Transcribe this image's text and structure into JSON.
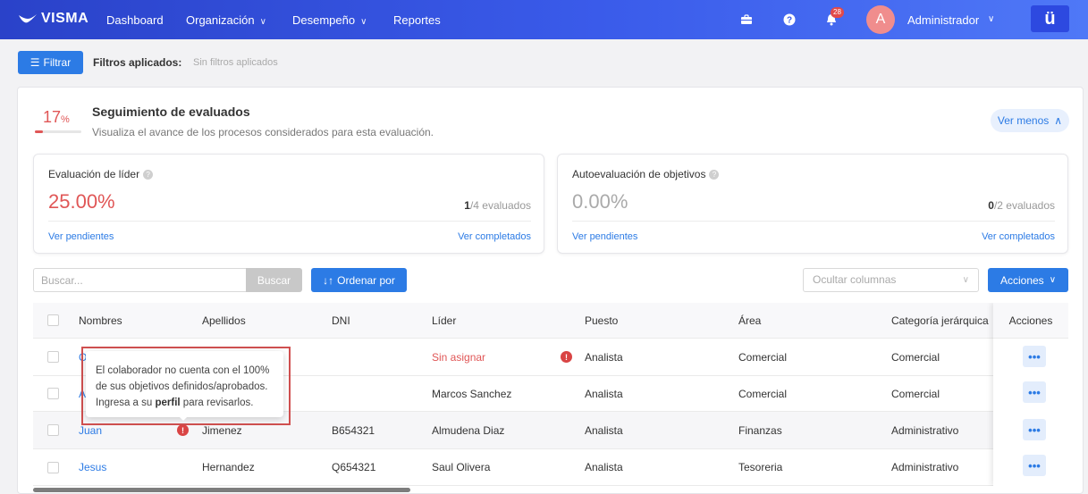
{
  "brand": {
    "logo": "VISMA",
    "app_mark": "ü",
    "accent": "#2c7be5",
    "alert": "#e05656"
  },
  "nav": {
    "items": [
      {
        "label": "Dashboard",
        "dropdown": false
      },
      {
        "label": "Organización",
        "dropdown": true
      },
      {
        "label": "Desempeño",
        "dropdown": true
      },
      {
        "label": "Reportes",
        "dropdown": false
      }
    ],
    "icons": [
      "briefcase-icon",
      "help-icon",
      "bell-icon"
    ],
    "notifications_count": "28",
    "user": {
      "initial": "A",
      "name": "Administrador"
    }
  },
  "filters": {
    "button_label": "Filtrar",
    "applied_label": "Filtros aplicados:",
    "applied_value": "Sin filtros aplicados"
  },
  "tracking": {
    "percent": "17",
    "percent_unit": "%",
    "progress": 0.17,
    "title": "Seguimiento de evaluados",
    "subtitle": "Visualiza el avance de los procesos considerados para esta evaluación.",
    "toggle_label": "Ver menos"
  },
  "cards": [
    {
      "title": "Evaluación de líder",
      "percent": "25.00%",
      "count": "1",
      "count_suffix": "/4 evaluados",
      "link_left": "Ver pendientes",
      "link_right": "Ver completados",
      "percent_color": "#e05656"
    },
    {
      "title": "Autoevaluación de objetivos",
      "percent": "0.00%",
      "count": "0",
      "count_suffix": "/2 evaluados",
      "link_left": "Ver pendientes",
      "link_right": "Ver completados",
      "percent_color": "#aaaaaa"
    }
  ],
  "toolbar": {
    "search_placeholder": "Buscar...",
    "search_button": "Buscar",
    "order_button": "Ordenar por",
    "hide_columns_placeholder": "Ocultar columnas",
    "actions_button": "Acciones"
  },
  "table": {
    "columns": [
      "Nombres",
      "Apellidos",
      "DNI",
      "Líder",
      "Puesto",
      "Área",
      "Categoría jerárquica",
      "Acciones"
    ],
    "rows": [
      {
        "nombres": "O",
        "apellidos": "",
        "dni": "",
        "lider": "Sin asignar",
        "puesto": "Analista",
        "area": "Comercial",
        "categoria": "Comercial",
        "lider_warning": true,
        "name_warning": false
      },
      {
        "nombres": "Al",
        "apellidos": "",
        "dni": "",
        "lider": "Marcos Sanchez",
        "puesto": "Analista",
        "area": "Comercial",
        "categoria": "Comercial",
        "lider_warning": false,
        "name_warning": false
      },
      {
        "nombres": "Juan",
        "apellidos": "Jimenez",
        "dni": "B654321",
        "lider": "Almudena Diaz",
        "puesto": "Analista",
        "area": "Finanzas",
        "categoria": "Administrativo",
        "lider_warning": false,
        "name_warning": true
      },
      {
        "nombres": "Jesus",
        "apellidos": "Hernandez",
        "dni": "Q654321",
        "lider": "Saul Olivera",
        "puesto": "Analista",
        "area": "Tesoreria",
        "categoria": "Administrativo",
        "lider_warning": false,
        "name_warning": false
      }
    ],
    "row_action_label": "•••"
  },
  "tooltip": {
    "line1": "El colaborador no cuenta con el 100%",
    "line2": "de sus objetivos definidos/aprobados.",
    "line3_prefix": "Ingresa a su ",
    "line3_bold": "perfil",
    "line3_suffix": " para revisarlos."
  }
}
